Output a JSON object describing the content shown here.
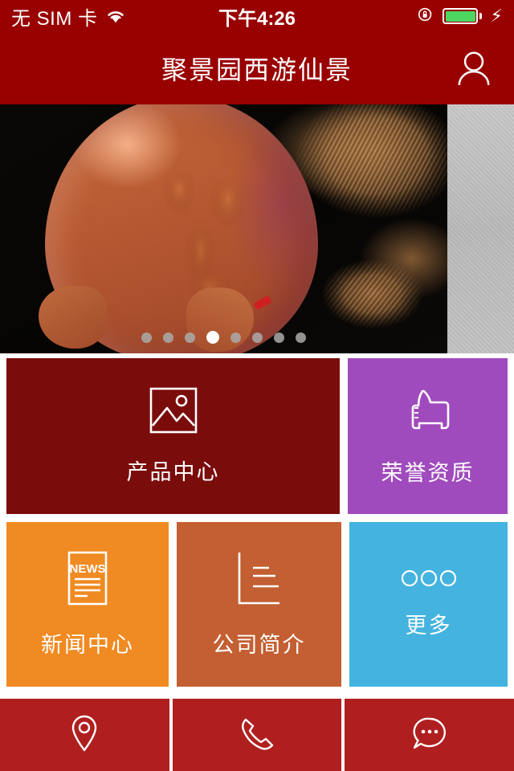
{
  "status_bar": {
    "carrier": "无 SIM 卡",
    "wifi_icon": "wifi-icon",
    "time": "下午4:26",
    "rotation_lock_icon": "rotation-lock-icon",
    "battery_icon": "battery-icon",
    "charging_icon": "lightning-bolt-icon",
    "battery_color": "#4CD662",
    "background_color": "#990000"
  },
  "header": {
    "title": "聚景园西游仙景",
    "avatar_icon": "user-avatar-icon",
    "background_color": "#990000"
  },
  "banner": {
    "slide_alt": "carved amber ornament on dark wood",
    "total_slides": 8,
    "active_slide": 4,
    "dots": [
      1,
      2,
      3,
      4,
      5,
      6,
      7,
      8
    ]
  },
  "grid": {
    "row1": [
      {
        "label": "产品中心",
        "icon": "image-picture-icon",
        "color": "#7B0C0C"
      },
      {
        "label": "荣誉资质",
        "icon": "thumbs-up-icon",
        "color": "#A04BBD"
      }
    ],
    "row2": [
      {
        "label": "新闻中心",
        "icon": "news-paper-icon",
        "icon_text": "NEWS",
        "color": "#F08A22"
      },
      {
        "label": "公司简介",
        "icon": "document-lines-icon",
        "color": "#C35F32"
      },
      {
        "label": "更多",
        "icon": "three-circles-more-icon",
        "color": "#44B3DF"
      }
    ]
  },
  "bottom_bar": {
    "background_color": "#B01F1F",
    "items": [
      {
        "icon": "location-pin-icon",
        "name": "map-location"
      },
      {
        "icon": "phone-handset-icon",
        "name": "call-phone"
      },
      {
        "icon": "chat-bubble-icon",
        "name": "message-chat"
      }
    ]
  }
}
